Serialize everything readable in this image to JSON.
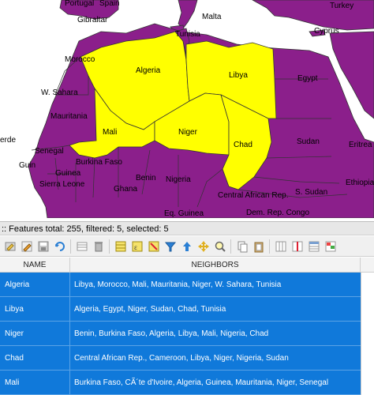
{
  "map": {
    "colors": {
      "selected": "#ffff00",
      "unselected": "#8b1f8b",
      "border": "#333333",
      "background": "#ffffff"
    },
    "labels": {
      "portugal": "Portugal",
      "spain": "Spain",
      "gibraltar": "Gibraltar",
      "tunisia": "Tunisia",
      "malta": "Malta",
      "turkey": "Turkey",
      "cyprus": "Cyprus",
      "morocco": "Morocco",
      "algeria": "Algeria",
      "libya": "Libya",
      "egypt": "Egypt",
      "w_sahara": "W. Sahara",
      "mauritania": "Mauritania",
      "mali": "Mali",
      "niger": "Niger",
      "chad": "Chad",
      "sudan": "Sudan",
      "cabo_verde": "erde",
      "senegal": "Senegal",
      "guinea_bissau": "Guin",
      "guinea": "Guinea",
      "sierra_leone": "Sierra Leone",
      "burkina_faso": "Burkina Faso",
      "ghana": "Ghana",
      "benin": "Benin",
      "nigeria": "Nigeria",
      "car": "Central African Rep.",
      "s_sudan": "S. Sudan",
      "eritrea": "Eritrea",
      "ethiopia": "Ethiopia",
      "eq_guinea": "Eq. Guinea",
      "dem_rep_congo": "Dem. Rep. Congo"
    }
  },
  "status": {
    "text": ":: Features total: 255, filtered: 5, selected: 5"
  },
  "toolbar": {
    "icons": [
      "toggle-edit-icon",
      "edit-pencil-icon",
      "save-edits-icon",
      "reload-icon",
      "add-feature-icon",
      "delete-feature-icon",
      "select-all-icon",
      "select-expression-icon",
      "deselect-icon",
      "filter-icon",
      "move-selection-top-icon",
      "pan-to-selection-icon",
      "zoom-to-selection-icon",
      "copy-icon",
      "paste-icon",
      "new-field-icon",
      "delete-field-icon",
      "field-calculator-icon",
      "conditional-format-icon"
    ]
  },
  "table": {
    "headers": {
      "name": "NAME",
      "neighbors": "NEIGHBORS"
    },
    "rows": [
      {
        "name": "Algeria",
        "neighbors": "Libya, Morocco, Mali, Mauritania, Niger, W. Sahara, Tunisia"
      },
      {
        "name": "Libya",
        "neighbors": "Algeria, Egypt, Niger, Sudan, Chad, Tunisia"
      },
      {
        "name": "Niger",
        "neighbors": "Benin, Burkina Faso, Algeria, Libya, Mali, Nigeria, Chad"
      },
      {
        "name": "Chad",
        "neighbors": "Central African Rep., Cameroon, Libya, Niger, Nigeria, Sudan"
      },
      {
        "name": "Mali",
        "neighbors": "Burkina Faso, CÃ´te d'Ivoire, Algeria, Guinea, Mauritania, Niger, Senegal"
      }
    ]
  }
}
